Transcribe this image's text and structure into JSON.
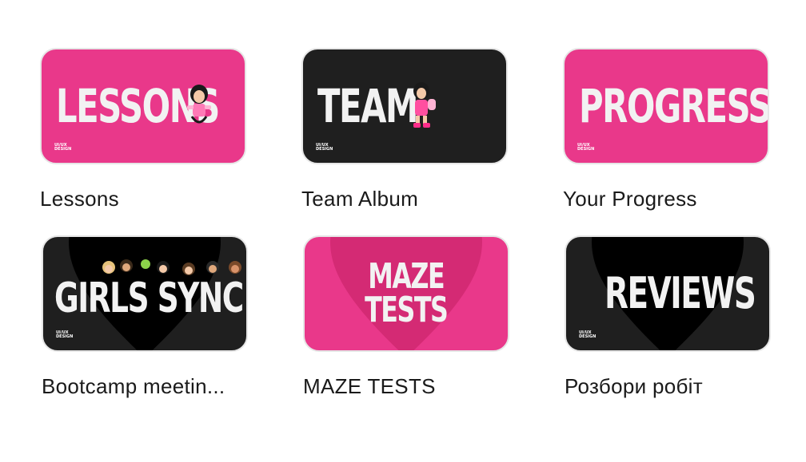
{
  "cards": [
    {
      "label": "Lessons",
      "thumb_text": "LESSONS",
      "theme": "pink",
      "logo": "UI/UX DESIGN"
    },
    {
      "label": "Team Album",
      "thumb_text": "TEAM",
      "theme": "dark",
      "logo": "UI/UX DESIGN"
    },
    {
      "label": "Your Progress",
      "thumb_text": "PROGRESS",
      "theme": "pink",
      "logo": "UI/UX DESIGN"
    },
    {
      "label": "Bootcamp meetin...",
      "thumb_text": "GIRLS SYNC",
      "theme": "dark",
      "logo": "UI/UX DESIGN"
    },
    {
      "label": "MAZE TESTS",
      "thumb_text_line1": "MAZE",
      "thumb_text_line2": "TESTS",
      "theme": "pink"
    },
    {
      "label": "Розбори робіт",
      "thumb_text": "REVIEWS",
      "theme": "dark",
      "logo": "UI/UX DESIGN"
    }
  ],
  "colors": {
    "pink": "#e9388a",
    "dark": "#1f1f1f",
    "heart_pink": "#d42a74",
    "heart_dark": "#000000",
    "title_text": "#f2f2f2",
    "label_text": "#1a1a1a"
  }
}
